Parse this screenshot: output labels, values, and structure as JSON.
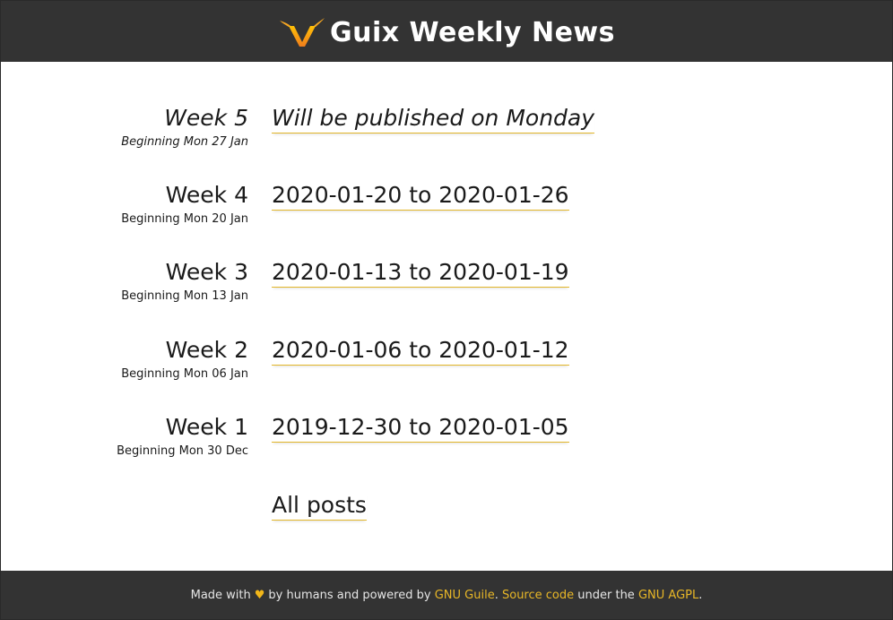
{
  "header": {
    "title": "Guix Weekly News",
    "logo_icon": "guix-logo-icon",
    "colors": {
      "background": "#333333",
      "logo_yellow": "#ffc107",
      "logo_orange": "#f07d1c"
    }
  },
  "weeks": [
    {
      "label": "Week 5",
      "beginning": "Beginning Mon 27 Jan",
      "link": "Will be published on Monday",
      "pending": true
    },
    {
      "label": "Week 4",
      "beginning": "Beginning Mon 20 Jan",
      "link": "2020-01-20 to 2020-01-26",
      "pending": false
    },
    {
      "label": "Week 3",
      "beginning": "Beginning Mon 13 Jan",
      "link": "2020-01-13 to 2020-01-19",
      "pending": false
    },
    {
      "label": "Week 2",
      "beginning": "Beginning Mon 06 Jan",
      "link": "2020-01-06 to 2020-01-12",
      "pending": false
    },
    {
      "label": "Week 1",
      "beginning": "Beginning Mon 30 Dec",
      "link": "2019-12-30 to 2020-01-05",
      "pending": false
    }
  ],
  "all_posts_label": "All posts",
  "footer": {
    "made_with": "Made with",
    "heart": "♥",
    "by_humans": "by humans and powered by",
    "guile_link": "GNU Guile",
    "period1": ".",
    "source_link": "Source code",
    "under_the": "under the",
    "license_link": "GNU AGPL",
    "period2": ".",
    "link_color": "#e8b727"
  }
}
